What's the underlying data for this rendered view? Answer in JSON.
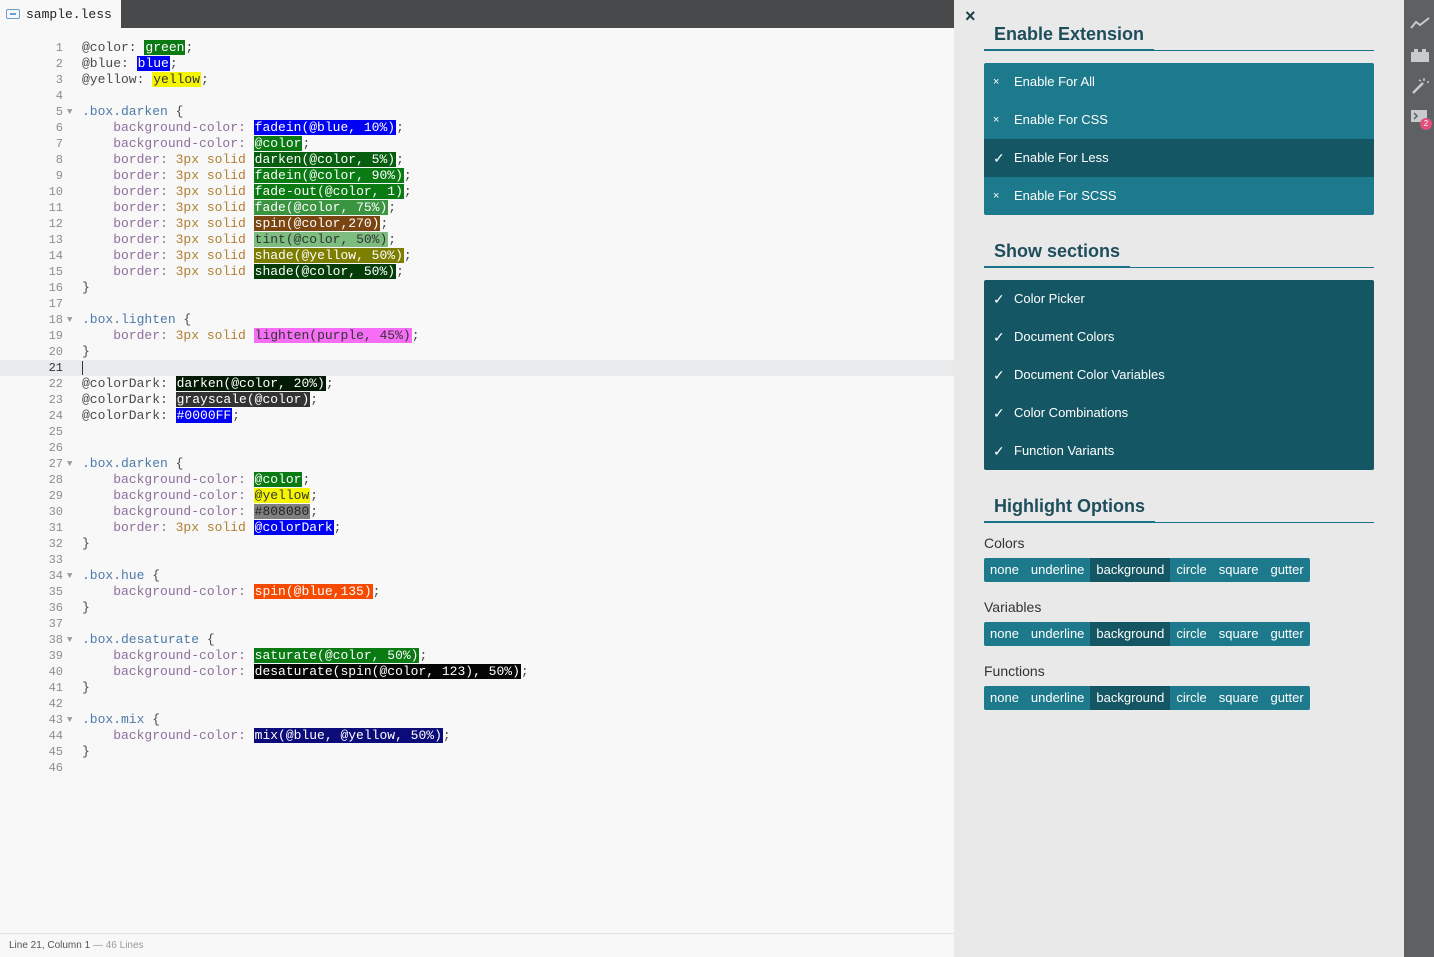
{
  "tab": {
    "filename": "sample.less",
    "icon": "less-file-icon"
  },
  "status": {
    "position": "Line 21, Column 1",
    "lines": " — 46 Lines"
  },
  "active_line": 21,
  "folds": [
    5,
    18,
    27,
    34,
    38,
    43
  ],
  "code_lines": [
    [
      [
        "@color: ",
        "var"
      ],
      [
        "green",
        "hl",
        "#0a7a12",
        "#ffffff"
      ],
      [
        ";",
        "punc"
      ]
    ],
    [
      [
        "@blue: ",
        "var"
      ],
      [
        "blue",
        "hl",
        "#0000f5",
        "#ffffff"
      ],
      [
        ";",
        "punc"
      ]
    ],
    [
      [
        "@yellow: ",
        "var"
      ],
      [
        "yellow",
        "hl",
        "#f5f500",
        "#333333"
      ],
      [
        ";",
        "punc"
      ]
    ],
    [],
    [
      [
        ".box.darken",
        "sel"
      ],
      [
        " {",
        "punc"
      ]
    ],
    [
      [
        "    background-color: ",
        "prop"
      ],
      [
        "fadein(@blue, 10%)",
        "hl",
        "#0000f5",
        "#ffffff"
      ],
      [
        ";",
        "punc"
      ]
    ],
    [
      [
        "    background-color: ",
        "prop"
      ],
      [
        "@color",
        "hl",
        "#0a7a12",
        "#ffffff"
      ],
      [
        ";",
        "punc"
      ]
    ],
    [
      [
        "    border: ",
        "prop"
      ],
      [
        "3px ",
        "num"
      ],
      [
        "solid ",
        "kw"
      ],
      [
        "darken(@color, 5%)",
        "hl",
        "#075e0e",
        "#ffffff"
      ],
      [
        ";",
        "punc"
      ]
    ],
    [
      [
        "    border: ",
        "prop"
      ],
      [
        "3px ",
        "num"
      ],
      [
        "solid ",
        "kw"
      ],
      [
        "fadein(@color, 90%)",
        "hl",
        "#0a7a12",
        "#ffffff"
      ],
      [
        ";",
        "punc"
      ]
    ],
    [
      [
        "    border: ",
        "prop"
      ],
      [
        "3px ",
        "num"
      ],
      [
        "solid ",
        "kw"
      ],
      [
        "fade-out(@color, 1)",
        "hl",
        "#0a7a12",
        "#ffffff"
      ],
      [
        ";",
        "punc"
      ]
    ],
    [
      [
        "    border: ",
        "prop"
      ],
      [
        "3px ",
        "num"
      ],
      [
        "solid ",
        "kw"
      ],
      [
        "fade(@color, 75%)",
        "hl",
        "#3a9440",
        "#ffffff"
      ],
      [
        ";",
        "punc"
      ]
    ],
    [
      [
        "    border: ",
        "prop"
      ],
      [
        "3px ",
        "num"
      ],
      [
        "solid ",
        "kw"
      ],
      [
        "spin(@color,270)",
        "hl",
        "#7a4510",
        "#ffffff"
      ],
      [
        ";",
        "punc"
      ]
    ],
    [
      [
        "    border: ",
        "prop"
      ],
      [
        "3px ",
        "num"
      ],
      [
        "solid ",
        "kw"
      ],
      [
        "tint(@color, 50%)",
        "hl",
        "#7dbd80",
        "#333333"
      ],
      [
        ";",
        "punc"
      ]
    ],
    [
      [
        "    border: ",
        "prop"
      ],
      [
        "3px ",
        "num"
      ],
      [
        "solid ",
        "kw"
      ],
      [
        "shade(@yellow, 50%)",
        "hl",
        "#7d7d00",
        "#ffffff"
      ],
      [
        ";",
        "punc"
      ]
    ],
    [
      [
        "    border: ",
        "prop"
      ],
      [
        "3px ",
        "num"
      ],
      [
        "solid ",
        "kw"
      ],
      [
        "shade(@color, 50%)",
        "hl",
        "#053d09",
        "#ffffff"
      ],
      [
        ";",
        "punc"
      ]
    ],
    [
      [
        "}",
        "punc"
      ]
    ],
    [],
    [
      [
        ".box.lighten",
        "sel"
      ],
      [
        " {",
        "punc"
      ]
    ],
    [
      [
        "    border: ",
        "prop"
      ],
      [
        "3px ",
        "num"
      ],
      [
        "solid ",
        "kw"
      ],
      [
        "lighten(purple, 45%)",
        "hl",
        "#f56ef5",
        "#333333"
      ],
      [
        ";",
        "punc"
      ]
    ],
    [
      [
        "}",
        "punc"
      ]
    ],
    [],
    [
      [
        "@colorDark: ",
        "var"
      ],
      [
        "darken(@color, 20%)",
        "hl",
        "#021a04",
        "#ffffff"
      ],
      [
        ";",
        "punc"
      ]
    ],
    [
      [
        "@colorDark: ",
        "var"
      ],
      [
        "grayscale(@color)",
        "hl",
        "#333333",
        "#ffffff"
      ],
      [
        ";",
        "punc"
      ]
    ],
    [
      [
        "@colorDark: ",
        "var"
      ],
      [
        "#0000FF",
        "hl",
        "#0000f5",
        "#ffffff"
      ],
      [
        ";",
        "punc"
      ]
    ],
    [],
    [],
    [
      [
        ".box.darken",
        "sel"
      ],
      [
        " {",
        "punc"
      ]
    ],
    [
      [
        "    background-color: ",
        "prop"
      ],
      [
        "@color",
        "hl",
        "#0a7a12",
        "#ffffff"
      ],
      [
        ";",
        "punc"
      ]
    ],
    [
      [
        "    background-color: ",
        "prop"
      ],
      [
        "@yellow",
        "hl",
        "#f5f500",
        "#333333"
      ],
      [
        ";",
        "punc"
      ]
    ],
    [
      [
        "    background-color: ",
        "prop"
      ],
      [
        "#808080",
        "hl",
        "#808080",
        "#222222"
      ],
      [
        ";",
        "punc"
      ]
    ],
    [
      [
        "    border: ",
        "prop"
      ],
      [
        "3px ",
        "num"
      ],
      [
        "solid ",
        "kw"
      ],
      [
        "@colorDark",
        "hl",
        "#0000f5",
        "#ffffff"
      ],
      [
        ";",
        "punc"
      ]
    ],
    [
      [
        "}",
        "punc"
      ]
    ],
    [],
    [
      [
        ".box.hue",
        "sel"
      ],
      [
        " {",
        "punc"
      ]
    ],
    [
      [
        "    background-color: ",
        "prop"
      ],
      [
        "spin(@blue,135)",
        "hl",
        "#f54a00",
        "#ffffff"
      ],
      [
        ";",
        "punc"
      ]
    ],
    [
      [
        "}",
        "punc"
      ]
    ],
    [],
    [
      [
        ".box.desaturate",
        "sel"
      ],
      [
        " {",
        "punc"
      ]
    ],
    [
      [
        "    background-color: ",
        "prop"
      ],
      [
        "saturate(@color, 50%)",
        "hl",
        "#0a7a12",
        "#ffffff"
      ],
      [
        ";",
        "punc"
      ]
    ],
    [
      [
        "    background-color: ",
        "prop"
      ],
      [
        "desaturate(spin(@color, 123), 50%)",
        "hl",
        "#050505",
        "#ffffff"
      ],
      [
        ";",
        "punc"
      ]
    ],
    [
      [
        "}",
        "punc"
      ]
    ],
    [],
    [
      [
        ".box.mix",
        "sel"
      ],
      [
        " {",
        "punc"
      ]
    ],
    [
      [
        "    background-color: ",
        "prop"
      ],
      [
        "mix(@blue, @yellow, 50%)",
        "hl",
        "#0b0b7a",
        "#ffffff"
      ],
      [
        ";",
        "punc"
      ]
    ],
    [
      [
        "}",
        "punc"
      ]
    ],
    []
  ],
  "panel": {
    "close_label": "×",
    "enable_title": "Enable Extension",
    "enable_options": [
      {
        "label": "Enable For All",
        "checked": false
      },
      {
        "label": "Enable For CSS",
        "checked": false
      },
      {
        "label": "Enable For Less",
        "checked": true
      },
      {
        "label": "Enable For SCSS",
        "checked": false
      }
    ],
    "sections_title": "Show sections",
    "section_options": [
      {
        "label": "Color Picker",
        "checked": true
      },
      {
        "label": "Document Colors",
        "checked": true
      },
      {
        "label": "Document Color Variables",
        "checked": true
      },
      {
        "label": "Color Combinations",
        "checked": true
      },
      {
        "label": "Function Variants",
        "checked": true
      }
    ],
    "highlight_title": "Highlight Options",
    "highlight_groups": [
      {
        "label": "Colors",
        "selected": "background"
      },
      {
        "label": "Variables",
        "selected": "background"
      },
      {
        "label": "Functions",
        "selected": "background"
      }
    ],
    "highlight_modes": [
      "none",
      "underline",
      "background",
      "circle",
      "square",
      "gutter"
    ],
    "check_mark": "✓",
    "cross_mark": "×"
  },
  "toolbar": {
    "icons": [
      "trend-chart-icon",
      "extension-brick-icon",
      "magic-wand-icon",
      "terminal-icon"
    ],
    "badge": "2"
  },
  "colors": {
    "accent": "#1d7a8c",
    "accent_dark": "#145664",
    "panel_bg": "#e9e9e9",
    "toolbar_bg": "#5e6164"
  }
}
